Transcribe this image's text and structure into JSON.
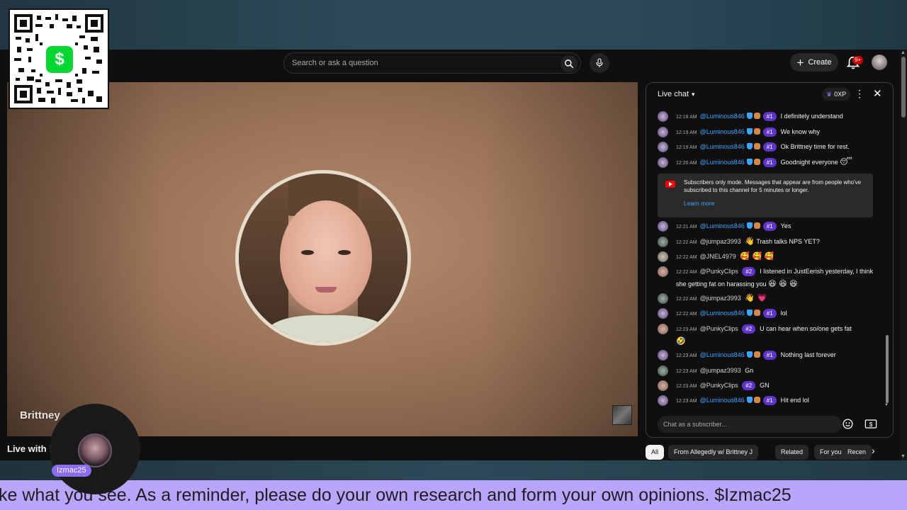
{
  "search": {
    "placeholder": "Search or ask a question"
  },
  "header": {
    "create_label": "Create",
    "notification_badge": "9+"
  },
  "qr": {
    "brand_symbol": "$"
  },
  "video": {
    "overlay_title": "Brittney",
    "live_title": "Live with I",
    "streamer_name": "Izmac25"
  },
  "chat": {
    "title": "Live chat",
    "xp_label": "0XP",
    "notice_text": "Subscribers only mode. Messages that appear are from people who've subscribed to this channel for 5 minutes or longer.",
    "notice_link": "Learn more",
    "input_placeholder": "Chat as a subscriber...",
    "messages": [
      {
        "time": "12:18 AM",
        "author": "@Luminous846",
        "rank": "#1",
        "text": "I definitely understand"
      },
      {
        "time": "12:19 AM",
        "author": "@Luminous846",
        "rank": "#1",
        "text": "We know why"
      },
      {
        "time": "12:19 AM",
        "author": "@Luminous846",
        "rank": "#1",
        "text": "Ok Brittney time for rest."
      },
      {
        "time": "12:20 AM",
        "author": "@Luminous846",
        "rank": "#1",
        "text": "Goodnight everyone",
        "emoji": "😴"
      },
      {
        "time": "12:21 AM",
        "author": "@Luminous846",
        "rank": "#1",
        "text": "Yes"
      },
      {
        "time": "12:22 AM",
        "author": "@jumpaz3993",
        "emoji_before": "👋",
        "text": "Trash talks NPS YET?"
      },
      {
        "time": "12:22 AM",
        "author": "@JNEL4979",
        "emoji": "🥰 🥰 🥰"
      },
      {
        "time": "12:22 AM",
        "author": "@PunkyClips",
        "rank": "#2",
        "text": "I listened in JustEerish yesterday, I think she getting fat on harassing you",
        "emoji": "😆 😆 😆"
      },
      {
        "time": "12:22 AM",
        "author": "@jumpaz3993",
        "emoji": "👋 💗"
      },
      {
        "time": "12:22 AM",
        "author": "@Luminous846",
        "rank": "#1",
        "text": "lol"
      },
      {
        "time": "12:23 AM",
        "author": "@PunkyClips",
        "rank": "#2",
        "text": "U can hear when so/one gets fat",
        "emoji": "🤣"
      },
      {
        "time": "12:23 AM",
        "author": "@Luminous846",
        "rank": "#1",
        "text": "Nothing last forever"
      },
      {
        "time": "12:23 AM",
        "author": "@jumpaz3993",
        "text": "Gn"
      },
      {
        "time": "12:23 AM",
        "author": "@PunkyClips",
        "rank": "#2",
        "text": "GN"
      },
      {
        "time": "12:23 AM",
        "author": "@Luminous846",
        "rank": "#1",
        "text": "Hit end lol"
      }
    ]
  },
  "chips": [
    "All",
    "From Allegedly w/ Brittney J",
    "Related",
    "For you",
    "Recen"
  ],
  "ticker": {
    "text": "ke what you see. As a reminder, please do your own research and form your own opinions. $Izmac25"
  }
}
